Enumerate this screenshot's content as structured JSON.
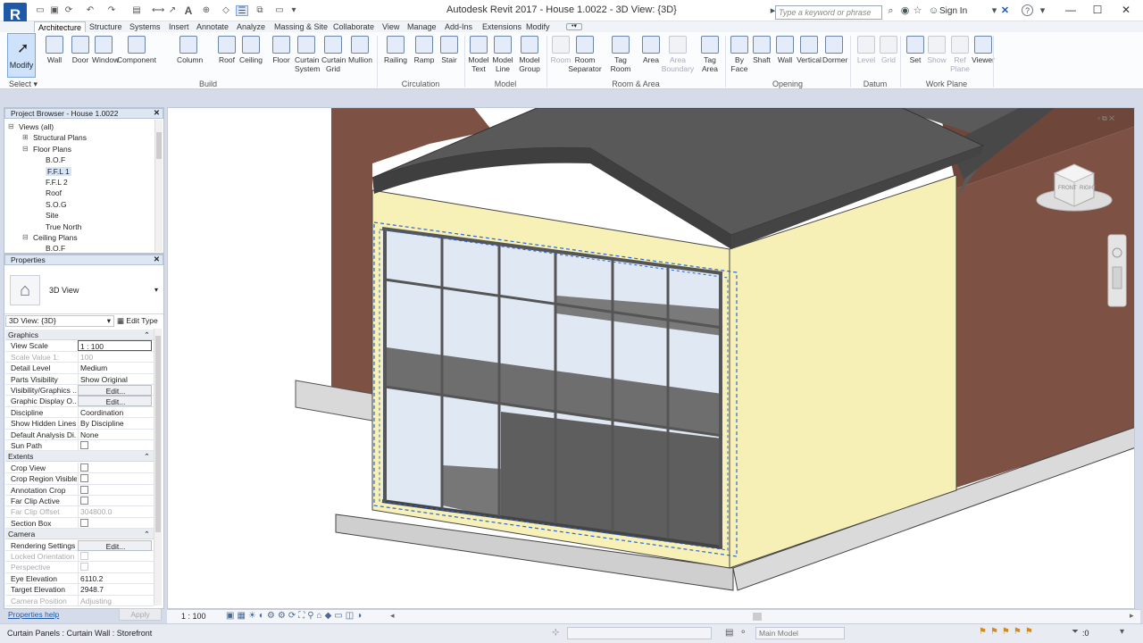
{
  "app": {
    "logo_letter": "R",
    "title": "Autodesk Revit 2017 -     House 1.0022 - 3D View: {3D}",
    "search_placeholder": "Type a keyword or phrase",
    "sign_in": "Sign In",
    "help": "?"
  },
  "tabs": [
    "Architecture",
    "Structure",
    "Systems",
    "Insert",
    "Annotate",
    "Analyze",
    "Massing & Site",
    "Collaborate",
    "View",
    "Manage",
    "Add-Ins",
    "Extensions",
    "Modify"
  ],
  "ribbon": {
    "modify": "Modify",
    "select": "Select",
    "buttons": [
      {
        "label": "Wall",
        "sub": ""
      },
      {
        "label": "Door",
        "sub": ""
      },
      {
        "label": "Window",
        "sub": ""
      },
      {
        "label": "Component",
        "sub": ""
      },
      {
        "label": "Column",
        "sub": ""
      },
      {
        "label": "Roof",
        "sub": ""
      },
      {
        "label": "Ceiling",
        "sub": ""
      },
      {
        "label": "Floor",
        "sub": ""
      },
      {
        "label": "Curtain",
        "sub": "System"
      },
      {
        "label": "Curtain",
        "sub": "Grid"
      },
      {
        "label": "Mullion",
        "sub": ""
      },
      {
        "label": "Railing",
        "sub": ""
      },
      {
        "label": "Ramp",
        "sub": ""
      },
      {
        "label": "Stair",
        "sub": ""
      },
      {
        "label": "Model",
        "sub": "Text"
      },
      {
        "label": "Model",
        "sub": "Line"
      },
      {
        "label": "Model",
        "sub": "Group"
      },
      {
        "label": "Room",
        "sub": ""
      },
      {
        "label": "Room",
        "sub": "Separator"
      },
      {
        "label": "Tag",
        "sub": "Room"
      },
      {
        "label": "Area",
        "sub": ""
      },
      {
        "label": "Area",
        "sub": "Boundary"
      },
      {
        "label": "Tag",
        "sub": "Area"
      },
      {
        "label": "By",
        "sub": "Face"
      },
      {
        "label": "Shaft",
        "sub": ""
      },
      {
        "label": "Wall",
        "sub": ""
      },
      {
        "label": "Vertical",
        "sub": ""
      },
      {
        "label": "Dormer",
        "sub": ""
      },
      {
        "label": "Level",
        "sub": ""
      },
      {
        "label": "Grid",
        "sub": ""
      },
      {
        "label": "Set",
        "sub": ""
      },
      {
        "label": "Show",
        "sub": ""
      },
      {
        "label": "Ref",
        "sub": "Plane"
      },
      {
        "label": "Viewer",
        "sub": ""
      }
    ],
    "panels": [
      "Build",
      "Circulation",
      "Model",
      "Room & Area",
      "Opening",
      "Datum",
      "Work Plane"
    ]
  },
  "project_browser": {
    "title": "Project Browser - House 1.0022",
    "items": [
      "Views (all)",
      "Structural Plans",
      "Floor Plans",
      "B.O.F",
      "F.F.L 1",
      "F.F.L 2",
      "Roof",
      "S.O.G",
      "Site",
      "True North",
      "Ceiling Plans",
      "B.O.F"
    ]
  },
  "properties": {
    "title": "Properties",
    "type_name": "3D View",
    "selector": "3D View: {3D}",
    "edit_type": "Edit Type",
    "sections": {
      "graphics": "Graphics",
      "extents": "Extents",
      "camera": "Camera"
    },
    "rows": [
      {
        "k": "View Scale",
        "v": "1 : 100"
      },
      {
        "k": "Scale Value    1:",
        "v": "100"
      },
      {
        "k": "Detail Level",
        "v": "Medium"
      },
      {
        "k": "Parts Visibility",
        "v": "Show Original"
      },
      {
        "k": "Visibility/Graphics ...",
        "v": "Edit..."
      },
      {
        "k": "Graphic Display O...",
        "v": "Edit..."
      },
      {
        "k": "Discipline",
        "v": "Coordination"
      },
      {
        "k": "Show Hidden Lines",
        "v": "By Discipline"
      },
      {
        "k": "Default Analysis Di...",
        "v": "None"
      },
      {
        "k": "Sun Path",
        "v": ""
      },
      {
        "k": "Crop View",
        "v": ""
      },
      {
        "k": "Crop Region Visible",
        "v": ""
      },
      {
        "k": "Annotation Crop",
        "v": ""
      },
      {
        "k": "Far Clip Active",
        "v": ""
      },
      {
        "k": "Far Clip Offset",
        "v": "304800.0"
      },
      {
        "k": "Section Box",
        "v": ""
      },
      {
        "k": "Rendering Settings",
        "v": "Edit..."
      },
      {
        "k": "Locked Orientation",
        "v": ""
      },
      {
        "k": "Perspective",
        "v": ""
      },
      {
        "k": "Eye Elevation",
        "v": "6110.2"
      },
      {
        "k": "Target Elevation",
        "v": "2948.7"
      },
      {
        "k": "Camera Position",
        "v": "Adjusting"
      }
    ],
    "help_link": "Properties help",
    "apply": "Apply"
  },
  "viewcube": {
    "front": "FRONT",
    "right": "RIGHT"
  },
  "view_control": {
    "scale": "1 : 100"
  },
  "status": {
    "text": "Curtain Panels : Curtain Wall : Storefront",
    "model": "Main Model",
    "filter_count": ":0"
  },
  "colors": {
    "accent": "#1e5aa8",
    "wall_cream": "#f7f1b8",
    "brick": "#7d5244",
    "roof": "#555555",
    "glass": "#d4e2f2",
    "selection": "#2b66d8"
  }
}
